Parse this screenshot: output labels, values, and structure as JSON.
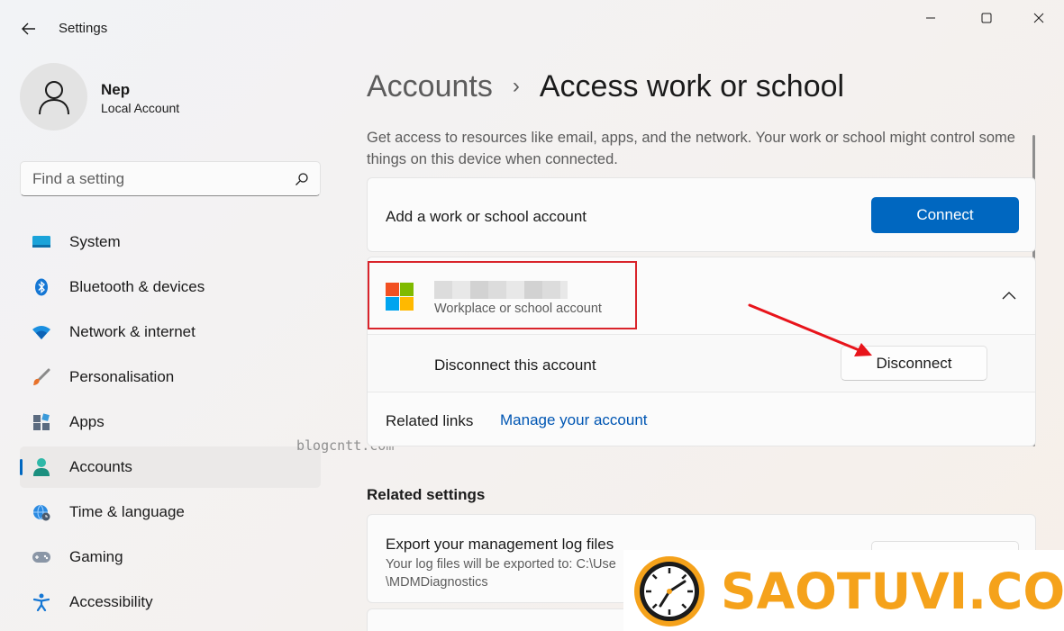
{
  "app": {
    "title": "Settings"
  },
  "profile": {
    "name": "Nep",
    "account_type": "Local Account"
  },
  "search": {
    "placeholder": "Find a setting"
  },
  "nav": {
    "items": [
      {
        "label": "System",
        "icon": "monitor-icon"
      },
      {
        "label": "Bluetooth & devices",
        "icon": "bluetooth-icon"
      },
      {
        "label": "Network & internet",
        "icon": "wifi-icon"
      },
      {
        "label": "Personalisation",
        "icon": "brush-icon"
      },
      {
        "label": "Apps",
        "icon": "apps-icon"
      },
      {
        "label": "Accounts",
        "icon": "person-icon",
        "active": true
      },
      {
        "label": "Time & language",
        "icon": "globe-clock-icon"
      },
      {
        "label": "Gaming",
        "icon": "gamepad-icon"
      },
      {
        "label": "Accessibility",
        "icon": "accessibility-icon"
      }
    ]
  },
  "watermark": "blogcntt.com",
  "breadcrumb": {
    "parent": "Accounts",
    "separator": "›",
    "current": "Access work or school"
  },
  "intro": "Get access to resources like email, apps, and the network. Your work or school might control some things on this device when connected.",
  "add_account": {
    "label": "Add a work or school account",
    "button": "Connect"
  },
  "account": {
    "type_label": "Workplace or school account",
    "disconnect_label": "Disconnect this account",
    "disconnect_button": "Disconnect",
    "related_links_label": "Related links",
    "manage_link": "Manage your account"
  },
  "related_settings": {
    "title": "Related settings",
    "log_title": "Export your management log files",
    "log_desc": "Your log files will be exported to: C:\\Use \\MDMDiagnostics"
  },
  "brand": {
    "text": "SAOTUVI.COM"
  },
  "colors": {
    "accent": "#0067c0",
    "annotation": "#d9242b",
    "brand": "#f5a21b"
  }
}
